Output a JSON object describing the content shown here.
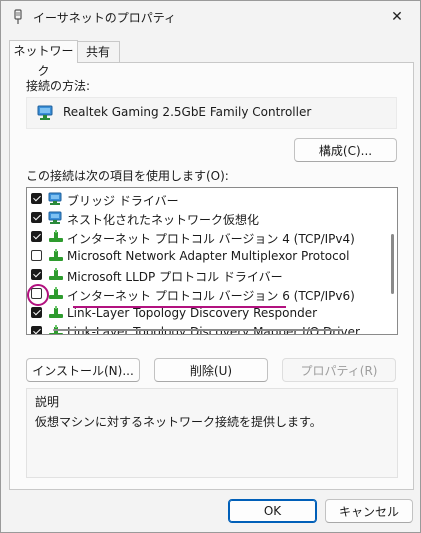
{
  "window": {
    "title": "イーサネットのプロパティ",
    "close_glyph": "✕"
  },
  "tabs": [
    {
      "label": "ネットワーク",
      "active": true
    },
    {
      "label": "共有",
      "active": false
    }
  ],
  "connect_using": {
    "label": "接続の方法:",
    "adapter": "Realtek Gaming 2.5GbE Family Controller",
    "configure_button": "構成(C)..."
  },
  "items_section": {
    "label": "この接続は次の項目を使用します(O):",
    "items": [
      {
        "label": "ブリッジ ドライバー",
        "checked": true,
        "icon": "network-client-icon"
      },
      {
        "label": "ネスト化されたネットワーク仮想化",
        "checked": true,
        "icon": "network-client-icon"
      },
      {
        "label": "インターネット プロトコル バージョン 4 (TCP/IPv4)",
        "checked": true,
        "icon": "protocol-icon"
      },
      {
        "label": "Microsoft Network Adapter Multiplexor Protocol",
        "checked": false,
        "icon": "protocol-icon"
      },
      {
        "label": "Microsoft LLDP プロトコル ドライバー",
        "checked": true,
        "icon": "protocol-icon"
      },
      {
        "label": "インターネット プロトコル バージョン 6 (TCP/IPv6)",
        "checked": false,
        "icon": "protocol-icon"
      },
      {
        "label": "Link-Layer Topology Discovery Responder",
        "checked": true,
        "icon": "protocol-icon"
      },
      {
        "label": "Link-Layer Topology Discovery Mapper I/O Driver",
        "checked": true,
        "icon": "protocol-icon"
      }
    ]
  },
  "item_buttons": {
    "install": "インストール(N)...",
    "uninstall": "削除(U)",
    "properties": "プロパティ(R)"
  },
  "description": {
    "title": "説明",
    "text": "仮想マシンに対するネットワーク接続を提供します。"
  },
  "dialog_buttons": {
    "ok": "OK",
    "cancel": "キャンセル"
  },
  "colors": {
    "accent": "#005fb8",
    "annotation": "#b2117f",
    "protocol_green": "#2e9b2e"
  }
}
